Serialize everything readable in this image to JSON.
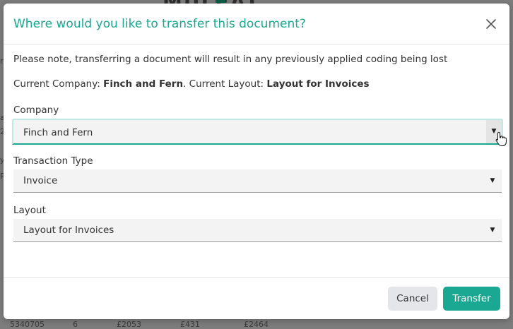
{
  "background": {
    "header_text": "MULEAT",
    "edge_labels": [
      "r",
      "a",
      "2",
      "y",
      "P"
    ],
    "row_cells": [
      "5340705",
      "6",
      "£2053",
      "£431",
      "£2464"
    ]
  },
  "dialog": {
    "title": "Where would you like to transfer this document?",
    "note": "Please note, transferring a document will result in any previously applied coding being lost",
    "current_company_label": "Current Company:",
    "current_company": "Finch and Fern",
    "current_layout_label": ". Current Layout:",
    "current_layout": "Layout for Invoices"
  },
  "fields": {
    "company": {
      "label": "Company",
      "value": "Finch and Fern"
    },
    "transaction_type": {
      "label": "Transaction Type",
      "value": "Invoice"
    },
    "layout": {
      "label": "Layout",
      "value": "Layout for Invoices"
    }
  },
  "buttons": {
    "cancel": "Cancel",
    "transfer": "Transfer"
  },
  "colors": {
    "accent": "#1aa893",
    "overlay": "#7d7d7d"
  },
  "icons": {
    "close": "close-icon",
    "dropdown": "caret-down-icon",
    "cursor": "hand-pointer-icon"
  }
}
